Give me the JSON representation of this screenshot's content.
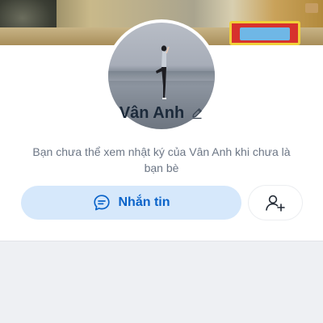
{
  "profile": {
    "name": "Vân Anh",
    "notice": "Bạn chưa thể xem nhật ký của Vân Anh khi chưa là bạn bè"
  },
  "actions": {
    "message_label": "Nhắn tin"
  },
  "icons": {
    "edit": "pencil-icon",
    "message": "chat-bubble-icon",
    "add_friend": "add-friend-icon"
  },
  "colors": {
    "accent": "#0a63c9",
    "message_button_bg": "#d6e8fb",
    "name_text": "#1c2a3a",
    "notice_text": "#6c7685"
  }
}
